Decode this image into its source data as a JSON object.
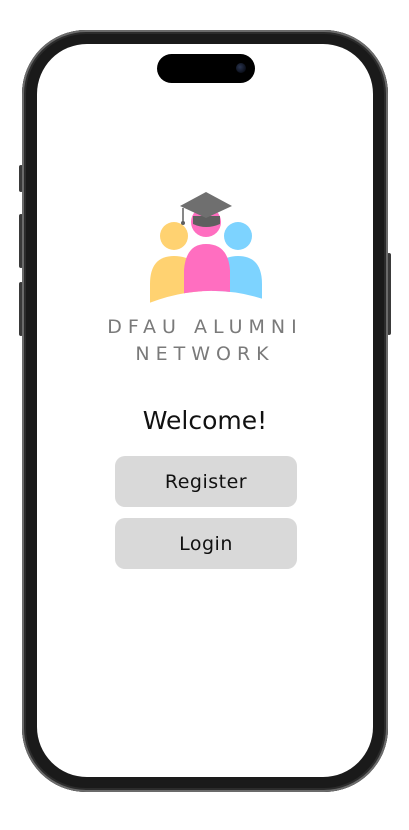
{
  "brand": {
    "line1": "DFAU ALUMNI",
    "line2": "NETWORK",
    "logo_icon": "alumni-graduation-logo-icon",
    "colors": {
      "cap": "#6f6f6f",
      "left_person": "#FFD271",
      "center_person": "#FF6EC0",
      "right_person": "#7DD3FF"
    }
  },
  "welcome": {
    "text": "Welcome!"
  },
  "actions": {
    "register_label": "Register",
    "login_label": "Login"
  },
  "theme": {
    "button_bg": "#d9d9d9",
    "text": "#111111",
    "brand_text": "#7a7a7a"
  }
}
